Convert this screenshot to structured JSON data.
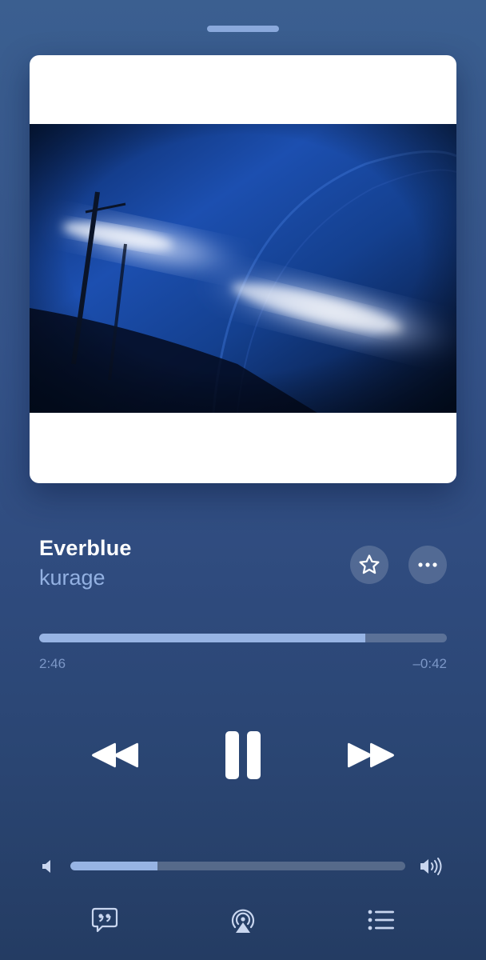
{
  "track": {
    "title": "Everblue",
    "artist": "kurage"
  },
  "playback": {
    "elapsed": "2:46",
    "remaining": "–0:42",
    "progress_fraction": 0.8,
    "state": "playing"
  },
  "volume": {
    "level_fraction": 0.26
  },
  "icons": {
    "favorite": "star-icon",
    "more": "ellipsis-icon",
    "rewind": "rewind-icon",
    "pause": "pause-icon",
    "forward": "fast-forward-icon",
    "volume_low": "speaker-low-icon",
    "volume_high": "speaker-high-icon",
    "lyrics": "lyrics-quote-icon",
    "airplay": "airplay-icon",
    "queue": "queue-list-icon"
  },
  "colors": {
    "background_top": "#3b5f90",
    "background_bottom": "#243c63",
    "accent": "#97b4e4",
    "artist_text": "#93b1e2",
    "time_text": "#7c97c7"
  }
}
